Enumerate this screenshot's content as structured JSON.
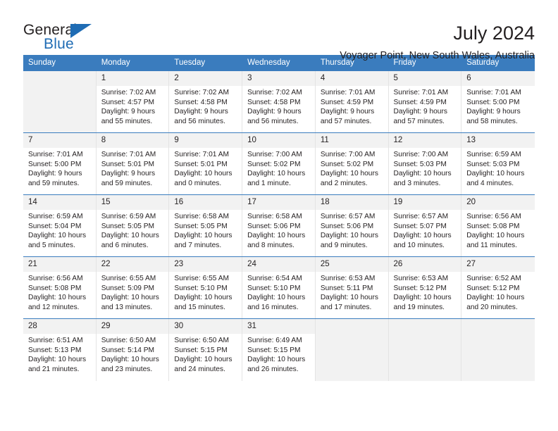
{
  "brand": {
    "name_part1": "General",
    "name_part2": "Blue",
    "triangle_color": "#1f6cb4"
  },
  "header": {
    "title": "July 2024",
    "subtitle": "Voyager Point, New South Wales, Australia"
  },
  "theme": {
    "header_bg": "#3a7cbe",
    "row_divider": "#3a7cbe",
    "daynum_bg": "#f2f2f2",
    "text": "#231f20"
  },
  "weekday_headers": [
    "Sunday",
    "Monday",
    "Tuesday",
    "Wednesday",
    "Thursday",
    "Friday",
    "Saturday"
  ],
  "weeks": [
    {
      "days": [
        {
          "date": "",
          "sunrise": "",
          "sunset": "",
          "daylight_line1": "",
          "daylight_line2": "",
          "empty": true
        },
        {
          "date": "1",
          "sunrise": "Sunrise: 7:02 AM",
          "sunset": "Sunset: 4:57 PM",
          "daylight_line1": "Daylight: 9 hours",
          "daylight_line2": "and 55 minutes.",
          "empty": false
        },
        {
          "date": "2",
          "sunrise": "Sunrise: 7:02 AM",
          "sunset": "Sunset: 4:58 PM",
          "daylight_line1": "Daylight: 9 hours",
          "daylight_line2": "and 56 minutes.",
          "empty": false
        },
        {
          "date": "3",
          "sunrise": "Sunrise: 7:02 AM",
          "sunset": "Sunset: 4:58 PM",
          "daylight_line1": "Daylight: 9 hours",
          "daylight_line2": "and 56 minutes.",
          "empty": false
        },
        {
          "date": "4",
          "sunrise": "Sunrise: 7:01 AM",
          "sunset": "Sunset: 4:59 PM",
          "daylight_line1": "Daylight: 9 hours",
          "daylight_line2": "and 57 minutes.",
          "empty": false
        },
        {
          "date": "5",
          "sunrise": "Sunrise: 7:01 AM",
          "sunset": "Sunset: 4:59 PM",
          "daylight_line1": "Daylight: 9 hours",
          "daylight_line2": "and 57 minutes.",
          "empty": false
        },
        {
          "date": "6",
          "sunrise": "Sunrise: 7:01 AM",
          "sunset": "Sunset: 5:00 PM",
          "daylight_line1": "Daylight: 9 hours",
          "daylight_line2": "and 58 minutes.",
          "empty": false
        }
      ]
    },
    {
      "days": [
        {
          "date": "7",
          "sunrise": "Sunrise: 7:01 AM",
          "sunset": "Sunset: 5:00 PM",
          "daylight_line1": "Daylight: 9 hours",
          "daylight_line2": "and 59 minutes.",
          "empty": false
        },
        {
          "date": "8",
          "sunrise": "Sunrise: 7:01 AM",
          "sunset": "Sunset: 5:01 PM",
          "daylight_line1": "Daylight: 9 hours",
          "daylight_line2": "and 59 minutes.",
          "empty": false
        },
        {
          "date": "9",
          "sunrise": "Sunrise: 7:01 AM",
          "sunset": "Sunset: 5:01 PM",
          "daylight_line1": "Daylight: 10 hours",
          "daylight_line2": "and 0 minutes.",
          "empty": false
        },
        {
          "date": "10",
          "sunrise": "Sunrise: 7:00 AM",
          "sunset": "Sunset: 5:02 PM",
          "daylight_line1": "Daylight: 10 hours",
          "daylight_line2": "and 1 minute.",
          "empty": false
        },
        {
          "date": "11",
          "sunrise": "Sunrise: 7:00 AM",
          "sunset": "Sunset: 5:02 PM",
          "daylight_line1": "Daylight: 10 hours",
          "daylight_line2": "and 2 minutes.",
          "empty": false
        },
        {
          "date": "12",
          "sunrise": "Sunrise: 7:00 AM",
          "sunset": "Sunset: 5:03 PM",
          "daylight_line1": "Daylight: 10 hours",
          "daylight_line2": "and 3 minutes.",
          "empty": false
        },
        {
          "date": "13",
          "sunrise": "Sunrise: 6:59 AM",
          "sunset": "Sunset: 5:03 PM",
          "daylight_line1": "Daylight: 10 hours",
          "daylight_line2": "and 4 minutes.",
          "empty": false
        }
      ]
    },
    {
      "days": [
        {
          "date": "14",
          "sunrise": "Sunrise: 6:59 AM",
          "sunset": "Sunset: 5:04 PM",
          "daylight_line1": "Daylight: 10 hours",
          "daylight_line2": "and 5 minutes.",
          "empty": false
        },
        {
          "date": "15",
          "sunrise": "Sunrise: 6:59 AM",
          "sunset": "Sunset: 5:05 PM",
          "daylight_line1": "Daylight: 10 hours",
          "daylight_line2": "and 6 minutes.",
          "empty": false
        },
        {
          "date": "16",
          "sunrise": "Sunrise: 6:58 AM",
          "sunset": "Sunset: 5:05 PM",
          "daylight_line1": "Daylight: 10 hours",
          "daylight_line2": "and 7 minutes.",
          "empty": false
        },
        {
          "date": "17",
          "sunrise": "Sunrise: 6:58 AM",
          "sunset": "Sunset: 5:06 PM",
          "daylight_line1": "Daylight: 10 hours",
          "daylight_line2": "and 8 minutes.",
          "empty": false
        },
        {
          "date": "18",
          "sunrise": "Sunrise: 6:57 AM",
          "sunset": "Sunset: 5:06 PM",
          "daylight_line1": "Daylight: 10 hours",
          "daylight_line2": "and 9 minutes.",
          "empty": false
        },
        {
          "date": "19",
          "sunrise": "Sunrise: 6:57 AM",
          "sunset": "Sunset: 5:07 PM",
          "daylight_line1": "Daylight: 10 hours",
          "daylight_line2": "and 10 minutes.",
          "empty": false
        },
        {
          "date": "20",
          "sunrise": "Sunrise: 6:56 AM",
          "sunset": "Sunset: 5:08 PM",
          "daylight_line1": "Daylight: 10 hours",
          "daylight_line2": "and 11 minutes.",
          "empty": false
        }
      ]
    },
    {
      "days": [
        {
          "date": "21",
          "sunrise": "Sunrise: 6:56 AM",
          "sunset": "Sunset: 5:08 PM",
          "daylight_line1": "Daylight: 10 hours",
          "daylight_line2": "and 12 minutes.",
          "empty": false
        },
        {
          "date": "22",
          "sunrise": "Sunrise: 6:55 AM",
          "sunset": "Sunset: 5:09 PM",
          "daylight_line1": "Daylight: 10 hours",
          "daylight_line2": "and 13 minutes.",
          "empty": false
        },
        {
          "date": "23",
          "sunrise": "Sunrise: 6:55 AM",
          "sunset": "Sunset: 5:10 PM",
          "daylight_line1": "Daylight: 10 hours",
          "daylight_line2": "and 15 minutes.",
          "empty": false
        },
        {
          "date": "24",
          "sunrise": "Sunrise: 6:54 AM",
          "sunset": "Sunset: 5:10 PM",
          "daylight_line1": "Daylight: 10 hours",
          "daylight_line2": "and 16 minutes.",
          "empty": false
        },
        {
          "date": "25",
          "sunrise": "Sunrise: 6:53 AM",
          "sunset": "Sunset: 5:11 PM",
          "daylight_line1": "Daylight: 10 hours",
          "daylight_line2": "and 17 minutes.",
          "empty": false
        },
        {
          "date": "26",
          "sunrise": "Sunrise: 6:53 AM",
          "sunset": "Sunset: 5:12 PM",
          "daylight_line1": "Daylight: 10 hours",
          "daylight_line2": "and 19 minutes.",
          "empty": false
        },
        {
          "date": "27",
          "sunrise": "Sunrise: 6:52 AM",
          "sunset": "Sunset: 5:12 PM",
          "daylight_line1": "Daylight: 10 hours",
          "daylight_line2": "and 20 minutes.",
          "empty": false
        }
      ]
    },
    {
      "days": [
        {
          "date": "28",
          "sunrise": "Sunrise: 6:51 AM",
          "sunset": "Sunset: 5:13 PM",
          "daylight_line1": "Daylight: 10 hours",
          "daylight_line2": "and 21 minutes.",
          "empty": false
        },
        {
          "date": "29",
          "sunrise": "Sunrise: 6:50 AM",
          "sunset": "Sunset: 5:14 PM",
          "daylight_line1": "Daylight: 10 hours",
          "daylight_line2": "and 23 minutes.",
          "empty": false
        },
        {
          "date": "30",
          "sunrise": "Sunrise: 6:50 AM",
          "sunset": "Sunset: 5:15 PM",
          "daylight_line1": "Daylight: 10 hours",
          "daylight_line2": "and 24 minutes.",
          "empty": false
        },
        {
          "date": "31",
          "sunrise": "Sunrise: 6:49 AM",
          "sunset": "Sunset: 5:15 PM",
          "daylight_line1": "Daylight: 10 hours",
          "daylight_line2": "and 26 minutes.",
          "empty": false
        },
        {
          "date": "",
          "sunrise": "",
          "sunset": "",
          "daylight_line1": "",
          "daylight_line2": "",
          "empty": true
        },
        {
          "date": "",
          "sunrise": "",
          "sunset": "",
          "daylight_line1": "",
          "daylight_line2": "",
          "empty": true
        },
        {
          "date": "",
          "sunrise": "",
          "sunset": "",
          "daylight_line1": "",
          "daylight_line2": "",
          "empty": true
        }
      ]
    }
  ]
}
